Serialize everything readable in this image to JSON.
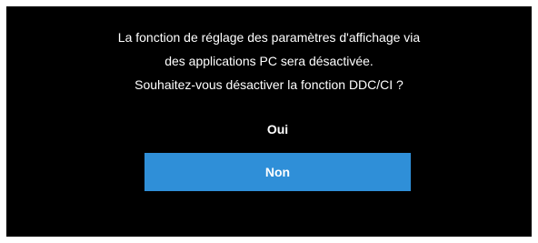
{
  "dialog": {
    "message_lines": [
      "La fonction de réglage des paramètres d'affichage via",
      "des applications PC sera désactivée.",
      "Souhaitez-vous désactiver la fonction DDC/CI ?"
    ],
    "options": {
      "yes_label": "Oui",
      "no_label": "Non",
      "selected": "Non"
    }
  },
  "colors": {
    "background": "#000000",
    "text": "#ffffff",
    "selection_highlight": "#2f8fd8"
  }
}
